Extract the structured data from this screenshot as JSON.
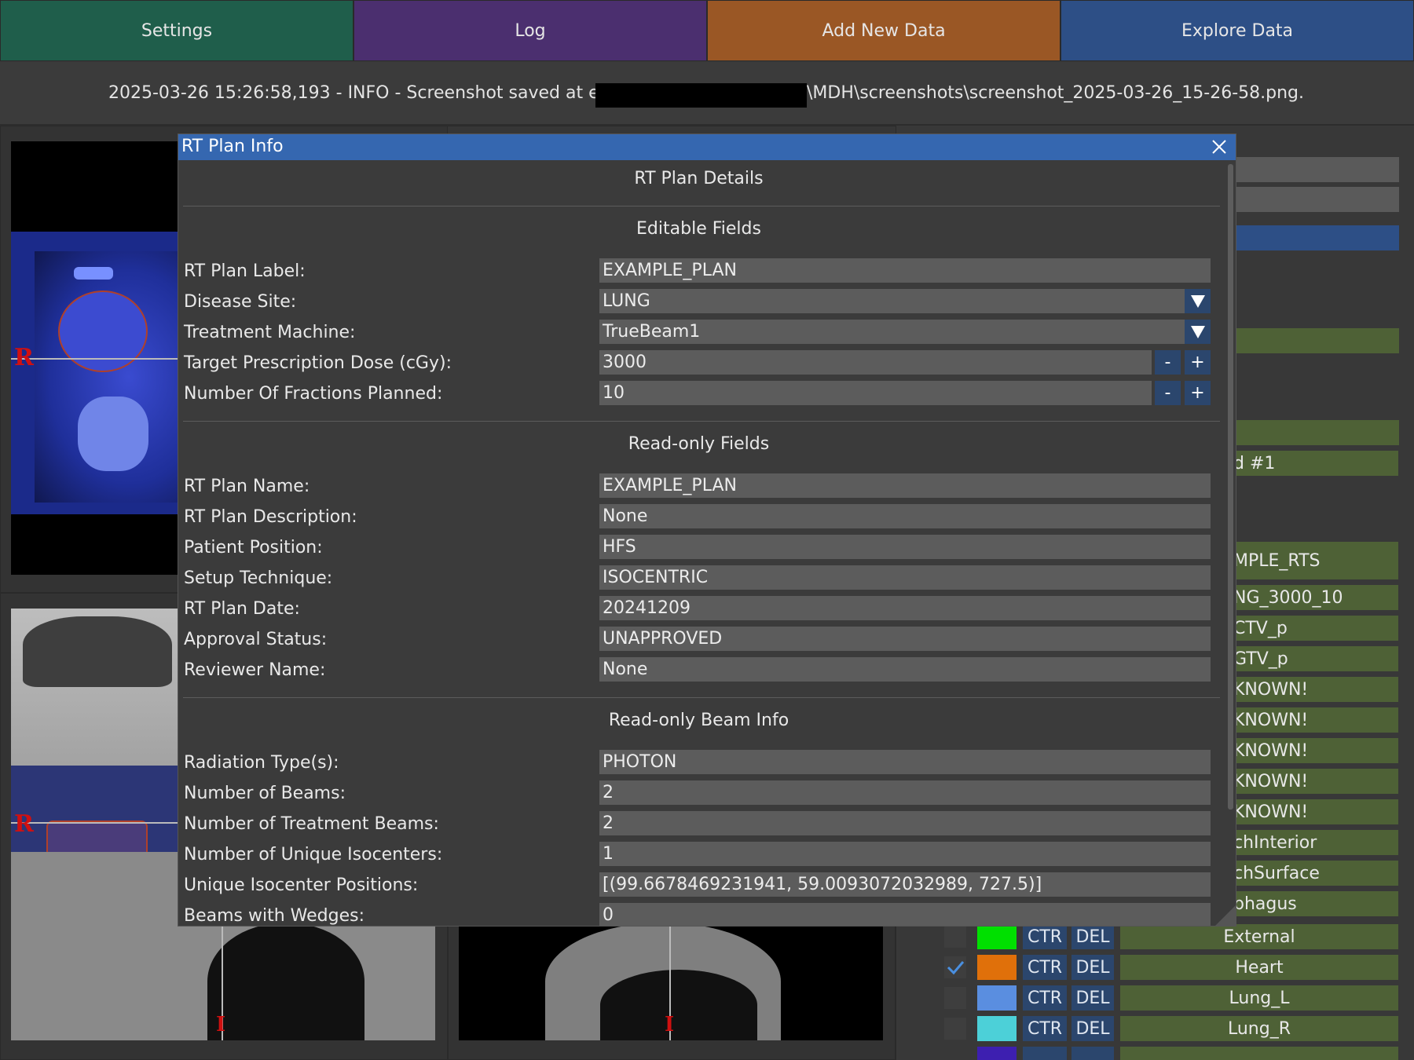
{
  "tabs": [
    {
      "label": "Settings",
      "color": "#1f5e4b"
    },
    {
      "label": "Log",
      "color": "#4b2f6f"
    },
    {
      "label": "Add New Data",
      "color": "#9a5725"
    },
    {
      "label": "Explore Data",
      "color": "#2d4f86"
    }
  ],
  "log": {
    "prefix": "2025-03-26 15:26:58,193 - INFO - Screenshot saved at e:\\",
    "suffix": "\\MDH\\screenshots\\screenshot_2025-03-26_15-26-58.png."
  },
  "viewer": {
    "orientation_marker": "R",
    "slice_marker": "I"
  },
  "structures": {
    "partial_labels": [
      "d #1",
      "MPLE_RTS",
      "NG_3000_10",
      "CTV_p",
      "GTV_p",
      "KNOWN!",
      "KNOWN!",
      "KNOWN!",
      "KNOWN!",
      "KNOWN!",
      "chInterior",
      "chSurface",
      "phagus"
    ],
    "rows": [
      {
        "color": "#00e000",
        "checked": false,
        "ctr": "CTR",
        "del": "DEL",
        "name": "External"
      },
      {
        "color": "#e0700a",
        "checked": true,
        "ctr": "CTR",
        "del": "DEL",
        "name": "Heart"
      },
      {
        "color": "#5a8ee0",
        "checked": false,
        "ctr": "CTR",
        "del": "DEL",
        "name": "Lung_L"
      },
      {
        "color": "#4cd0d8",
        "checked": false,
        "ctr": "CTR",
        "del": "DEL",
        "name": "Lung_R"
      }
    ]
  },
  "dialog": {
    "title": "RT Plan Info",
    "heading": "RT Plan Details",
    "editable_title": "Editable Fields",
    "editable": [
      {
        "label": "RT Plan Label:",
        "value": "EXAMPLE_PLAN",
        "kind": "text"
      },
      {
        "label": "Disease Site:",
        "value": "LUNG",
        "kind": "dropdown"
      },
      {
        "label": "Treatment Machine:",
        "value": "TrueBeam1",
        "kind": "dropdown"
      },
      {
        "label": "Target Prescription Dose (cGy):",
        "value": "3000",
        "kind": "spin"
      },
      {
        "label": "Number Of Fractions Planned:",
        "value": "10",
        "kind": "spin"
      }
    ],
    "spin_minus": "-",
    "spin_plus": "+",
    "readonly_title": "Read-only Fields",
    "readonly": [
      {
        "label": "RT Plan Name:",
        "value": "EXAMPLE_PLAN"
      },
      {
        "label": "RT Plan Description:",
        "value": "None"
      },
      {
        "label": "Patient Position:",
        "value": "HFS"
      },
      {
        "label": "Setup Technique:",
        "value": "ISOCENTRIC"
      },
      {
        "label": "RT Plan Date:",
        "value": "20241209"
      },
      {
        "label": "Approval Status:",
        "value": "UNAPPROVED"
      },
      {
        "label": "Reviewer Name:",
        "value": "None"
      }
    ],
    "beam_title": "Read-only Beam Info",
    "beam": [
      {
        "label": "Radiation Type(s):",
        "value": "PHOTON"
      },
      {
        "label": "Number of Beams:",
        "value": "2"
      },
      {
        "label": "Number of Treatment Beams:",
        "value": "2"
      },
      {
        "label": "Number of Unique Isocenters:",
        "value": "1"
      },
      {
        "label": "Unique Isocenter Positions:",
        "value": "[(99.6678469231941, 59.0093072032989, 727.5)]"
      },
      {
        "label": "Beams with Wedges:",
        "value": "0"
      }
    ]
  }
}
